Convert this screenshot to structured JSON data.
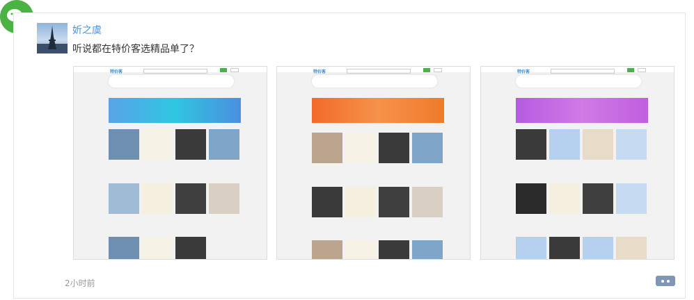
{
  "post": {
    "username": "妡之虞",
    "text": "听说都在特价客选精品单了？",
    "time": "2小时前"
  },
  "icons": {
    "app": "wechat-icon",
    "comment": "comment-icon"
  },
  "colors": {
    "wechat_green": "#4bb343",
    "username_blue": "#4a90d9",
    "comment_button": "#7f96b6",
    "banner_blue": "#2fb3e3",
    "banner_orange": "#f07a2a",
    "banner_purple": "#c05fe0"
  },
  "screenshots": [
    {
      "name": "screenshot-1",
      "theme": "blue"
    },
    {
      "name": "screenshot-2",
      "theme": "orange"
    },
    {
      "name": "screenshot-3",
      "theme": "purple"
    }
  ]
}
